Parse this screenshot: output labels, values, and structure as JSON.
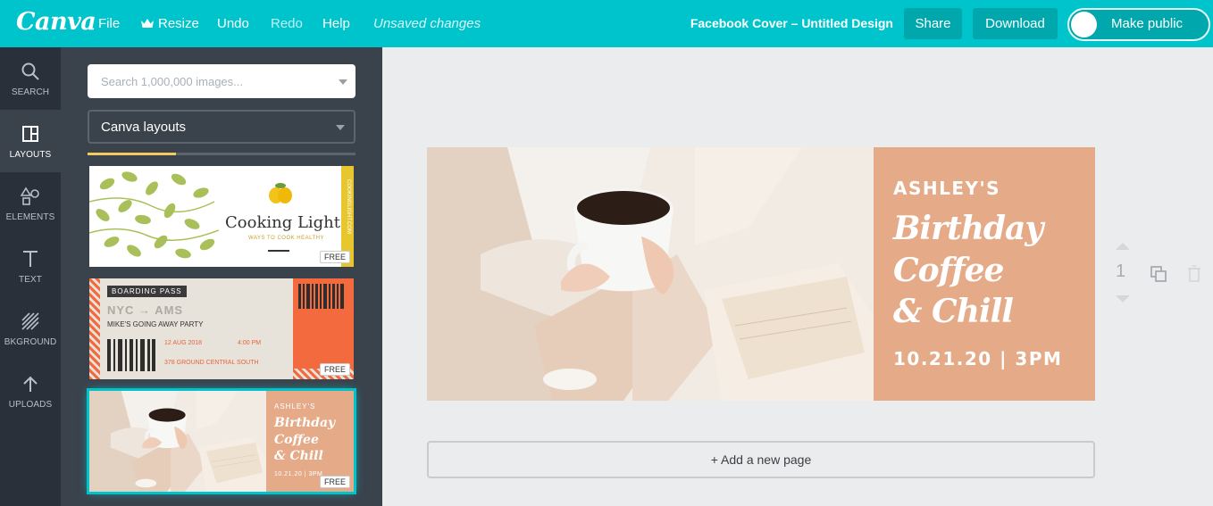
{
  "app": {
    "logo": "Canva"
  },
  "menu": {
    "file": "File",
    "resize": "Resize",
    "undo": "Undo",
    "redo": "Redo",
    "help": "Help",
    "status": "Unsaved changes"
  },
  "document": {
    "title": "Facebook Cover – Untitled Design"
  },
  "toolbar": {
    "share": "Share",
    "download": "Download",
    "make_public": "Make public"
  },
  "nav": {
    "items": [
      {
        "label": "SEARCH",
        "icon": "search-icon"
      },
      {
        "label": "LAYOUTS",
        "icon": "layout-icon"
      },
      {
        "label": "ELEMENTS",
        "icon": "shapes-icon"
      },
      {
        "label": "TEXT",
        "icon": "text-icon"
      },
      {
        "label": "BKGROUND",
        "icon": "background-icon"
      },
      {
        "label": "UPLOADS",
        "icon": "upload-arrow-icon"
      }
    ]
  },
  "panel": {
    "search_placeholder": "Search 1,000,000 images...",
    "filter_value": "Canva layouts",
    "load_progress": 0.33,
    "free_label": "FREE",
    "layouts": [
      {
        "title": "Cooking Light",
        "subtitle": "WAYS TO COOK HEALTHY",
        "side_text": "COOKINGLIGHT.COM"
      },
      {
        "tag": "BOARDING PASS",
        "route": "NYC → AMS",
        "party": "MIKE'S GOING AWAY PARTY",
        "date": "12 AUG 2018",
        "time": "4:00 PM",
        "address": "378 GROUND CENTRAL SOUTH"
      },
      {
        "name": "ASHLEY'S",
        "line1": "Birthday",
        "line2": "Coffee",
        "line3": "& Chill",
        "date": "10.21.20 | 3PM"
      }
    ]
  },
  "design": {
    "name": "ASHLEY'S",
    "line1": "Birthday",
    "line2": "Coffee",
    "line3": "& Chill",
    "date": "10.21.20 | 3PM",
    "box_color": "#e5ab89"
  },
  "page": {
    "number": "1",
    "add_page": "+ Add a new page"
  },
  "colors": {
    "brand": "#00c4cc",
    "nav_bg": "#293039",
    "panel_bg": "#3a424c"
  }
}
